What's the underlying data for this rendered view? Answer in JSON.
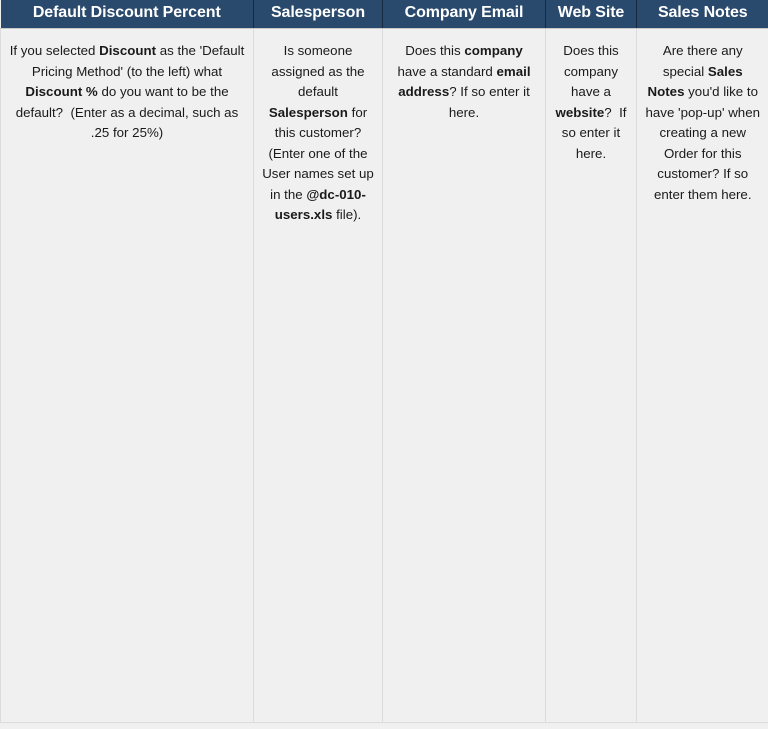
{
  "table": {
    "columns": [
      {
        "id": "default-discount-percent",
        "label": "Default Discount Percent"
      },
      {
        "id": "salesperson",
        "label": "Salesperson"
      },
      {
        "id": "company-email",
        "label": "Company Email"
      },
      {
        "id": "web-site",
        "label": "Web Site"
      },
      {
        "id": "sales-notes",
        "label": "Sales Notes"
      }
    ],
    "help_row": [
      {
        "id": "default-discount-percent",
        "text": "If you selected Discount as the 'Default Pricing Method' (to the left) what Discount % do you want to be the default?  (Enter as a decimal, such as .25 for 25%)",
        "html": "If you selected <b>Discount</b> as the 'Default Pricing Method' (to the left) what <b>Discount %</b> do you want to be the default? &nbsp;(Enter as a decimal, such as .25 for 25%)"
      },
      {
        "id": "salesperson",
        "text": "Is someone assigned as the default Salesperson for this customer? (Enter one of the User names set up in the @dc-010-users.xls file).",
        "html": "Is someone assigned as the default <b>Salesperson</b> for this customer? (Enter one of the User names set up in the <b>@dc-010-users.xls</b> file)."
      },
      {
        "id": "company-email",
        "text": "Does this company have a standard email address? If so enter it here.",
        "html": "Does this <b>company</b> have a standard <b>email address</b>? If so enter it here."
      },
      {
        "id": "web-site",
        "text": "Does this company have a website?  If so enter it here.",
        "html": "Does this company have a <b>website</b>? &nbsp;If so enter it here."
      },
      {
        "id": "sales-notes",
        "text": "Are there any special Sales Notes you'd like to have 'pop-up' when creating a new Order for this customer? If so enter them here.",
        "html": "Are there any special <b>Sales Notes</b> you'd like to have 'pop-up' when creating a new Order for this customer? If so enter them here."
      }
    ]
  },
  "colors": {
    "header_background": "#2a4a6d",
    "header_text": "#ffffff",
    "body_background": "#f0f0f0",
    "body_text": "#1a1a1a",
    "grid_line": "#dcdcdc"
  }
}
